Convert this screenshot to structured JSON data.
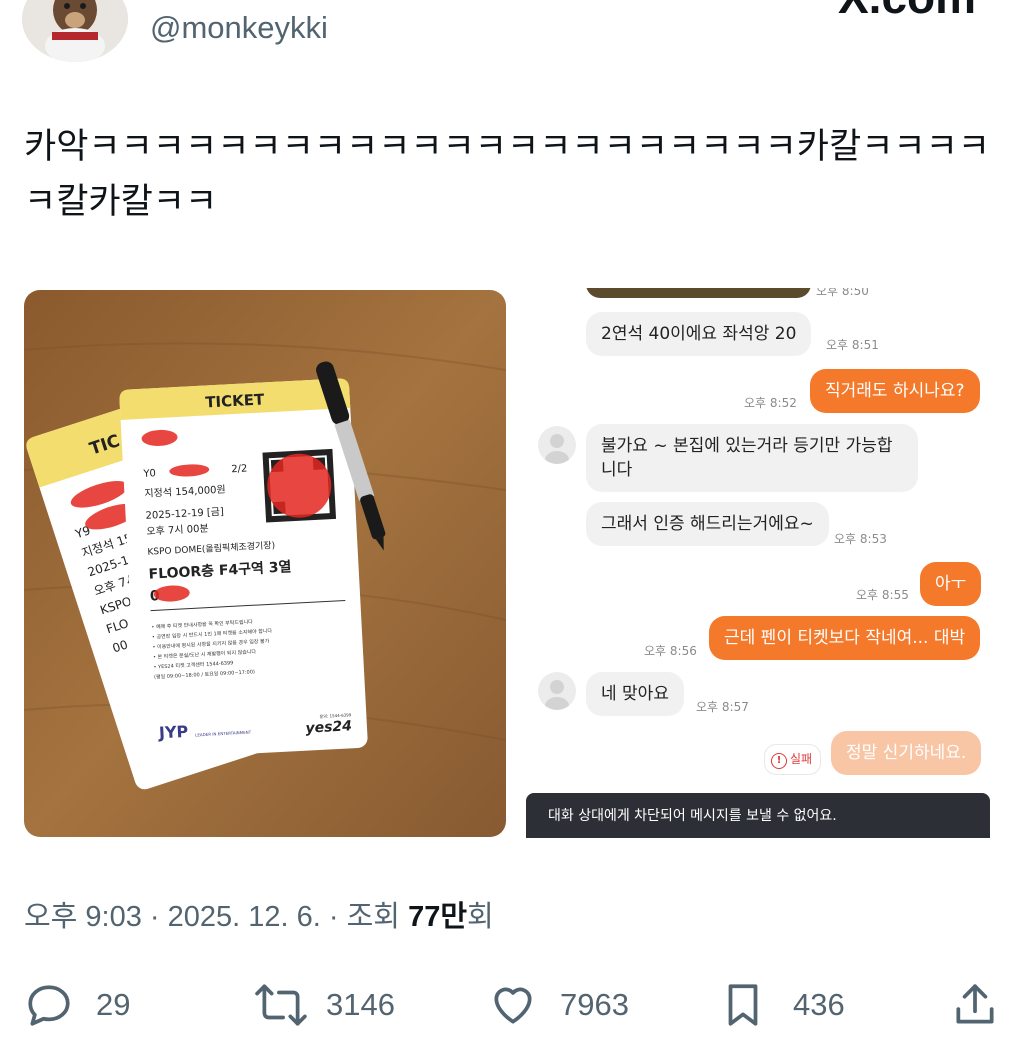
{
  "author": {
    "handle": "@monkeykki"
  },
  "brand": {
    "logo_text": "X.com"
  },
  "tweet": {
    "text": "카악ㅋㅋㅋㅋㅋㅋㅋㅋㅋㅋㅋㅋㅋㅋㅋㅋㅋㅋㅋㅋㅋㅋ카칼ㅋㅋㅋㅋㅋ칼카칼ㅋㅋ"
  },
  "ticket_photo": {
    "ticket_header": "TICKET",
    "ticket_header_back": "TIC",
    "seat_count": "2/2",
    "seat_grade": "지정석 154,000원",
    "date": "2025-12-19 [금]",
    "time": "오후 7시 00분",
    "venue": "KSPO DOME(올림픽체조경기장)",
    "seat": "FLOOR층 F4구역 3열",
    "seat_num_prefix": "0",
    "back_lines": [
      "Y9",
      "지정석 154",
      "2025-12",
      "오후 7시",
      "KSPO",
      "FLO",
      "00"
    ],
    "notice_lines": [
      "• 예매 후 티켓 안내사항을 꼭 확인 부탁드립니다",
      "• 공연장 입장 시 반드시 1인 1매 티켓을 소지해야 합니다",
      "• 이용안내에 명시된 사항을 지키지 않을 경우 입장 불가",
      "• 본 티켓은 분실/도난 시 재발행이 되지 않습니다",
      "• YES24 티켓 고객센터 1544-6399",
      "(평일 09:00~18:00 / 토요일 09:00~17:00)"
    ],
    "jyp_text": "JYP",
    "jyp_sub": "LEADER IN ENTERTAINMENT",
    "yes24_text": "yes24",
    "yes24_small": "문의: 1544-6399"
  },
  "chat": {
    "messages": [
      {
        "dir": "in",
        "text": "2연석 40이에요 좌석앙 20",
        "time": "오후 8:51"
      },
      {
        "dir": "out",
        "text": "직거래도 하시나요?",
        "time": "오후 8:52"
      },
      {
        "dir": "in",
        "text": "불가요 ~ 본집에 있는거라 등기만 가능합니다",
        "time": ""
      },
      {
        "dir": "in",
        "text": "그래서 인증 해드리는거에요~",
        "time": "오후 8:53"
      },
      {
        "dir": "out",
        "text": "아ㅜ",
        "time": "오후 8:55"
      },
      {
        "dir": "out",
        "text": "근데 펜이 티켓보다 작네여... 대박",
        "time": "오후 8:56"
      },
      {
        "dir": "in",
        "text": "네 맞아요",
        "time": "오후 8:57"
      },
      {
        "dir": "out_failed",
        "text": "정말 신기하네요.",
        "time": ""
      }
    ],
    "top_time": "오후 8:50",
    "fail_label": "실패",
    "blocked_banner": "대화 상대에게 차단되어 메시지를 보낼 수 없어요."
  },
  "meta": {
    "time": "오후 9:03",
    "date": "2025. 12. 6.",
    "views_label": "조회",
    "views_count": "77만",
    "views_suffix": "회"
  },
  "actions": {
    "replies": "29",
    "retweets": "3146",
    "likes": "7963",
    "bookmarks": "436"
  },
  "colors": {
    "accent_orange": "#f4792b",
    "text_secondary": "#536471",
    "ticket_yellow": "#f2dd6e",
    "table_wood": "#9a6a3c"
  },
  "icons": [
    "reply-icon",
    "retweet-icon",
    "heart-icon",
    "bookmark-icon",
    "share-icon"
  ]
}
